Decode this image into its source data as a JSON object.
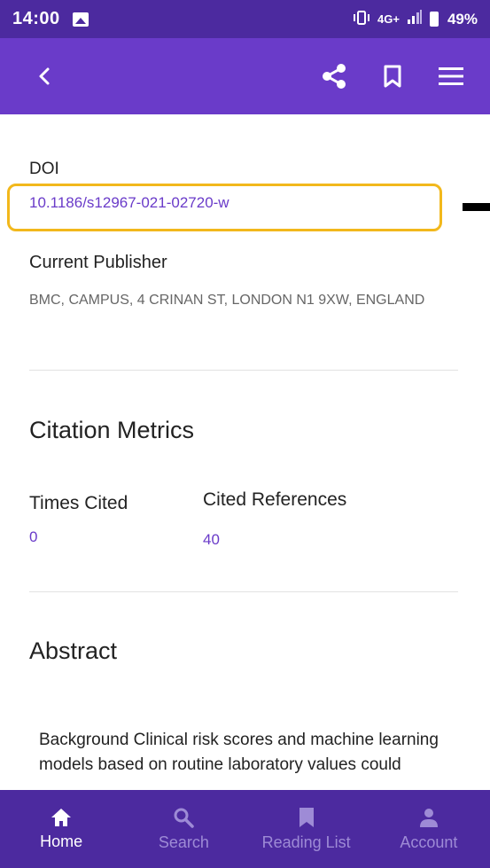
{
  "status_bar": {
    "time": "14:00",
    "network": "4G+",
    "battery": "49%"
  },
  "app_bar": {
    "icons": [
      "back-icon",
      "share-icon",
      "bookmark-icon",
      "menu-icon"
    ]
  },
  "doi": {
    "label": "DOI",
    "value": "10.1186/s12967-021-02720-w"
  },
  "publisher": {
    "label": "Current Publisher",
    "address": "BMC, CAMPUS, 4 CRINAN ST, LONDON N1 9XW, ENGLAND"
  },
  "citation_metrics": {
    "title": "Citation Metrics",
    "times_cited_label": "Times Cited",
    "times_cited_value": "0",
    "cited_references_label": "Cited References",
    "cited_references_value": "40"
  },
  "abstract": {
    "title": "Abstract",
    "text": "Background Clinical risk scores and machine learning models based on routine laboratory values could"
  },
  "bottom_nav": {
    "items": [
      {
        "label": "Home",
        "icon": "home-icon",
        "active": true
      },
      {
        "label": "Search",
        "icon": "search-icon",
        "active": false
      },
      {
        "label": "Reading List",
        "icon": "bookmark-icon",
        "active": false
      },
      {
        "label": "Account",
        "icon": "account-icon",
        "active": false
      }
    ]
  },
  "colors": {
    "status_bar": "#4c2a9f",
    "app_bar": "#6a3bc9",
    "link": "#6a3bc9",
    "highlight_border": "#f2b81c",
    "nav_inactive": "#9e8bd6"
  }
}
